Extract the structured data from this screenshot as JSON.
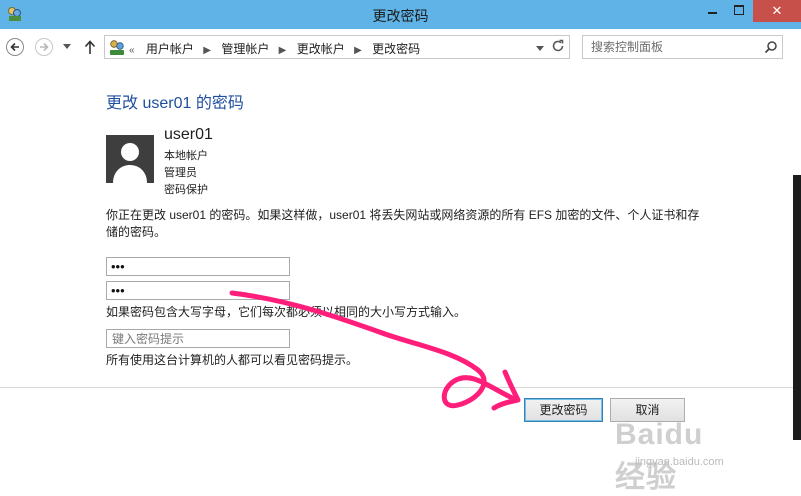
{
  "window": {
    "title": "更改密码"
  },
  "nav": {
    "breadcrumb_prefix": "«",
    "breadcrumbs": [
      "用户帐户",
      "管理帐户",
      "更改帐户",
      "更改密码"
    ],
    "search_placeholder": "搜索控制面板"
  },
  "content": {
    "page_title": "更改 user01 的密码",
    "user": {
      "name": "user01",
      "details": [
        "本地帐户",
        "管理员",
        "密码保护"
      ]
    },
    "warning": "你正在更改 user01 的密码。如果这样做，user01 将丢失网站或网络资源的所有 EFS 加密的文件、个人证书和存储的密码。",
    "new_password_value": "•••",
    "confirm_password_value": "•••",
    "case_note": "如果密码包含大写字母，它们每次都必须以相同的大小写方式输入。",
    "hint_placeholder": "键入密码提示",
    "hint_note": "所有使用这台计算机的人都可以看见密码提示。"
  },
  "buttons": {
    "change": "更改密码",
    "cancel": "取消"
  },
  "watermark": {
    "logo": "Baidu经验",
    "url": "jingyan.baidu.com"
  },
  "colors": {
    "titlebar": "#5fb3e6",
    "close": "#c7504a",
    "link_title": "#1f4fa0",
    "annotation_ink": "#ff1f7a"
  }
}
